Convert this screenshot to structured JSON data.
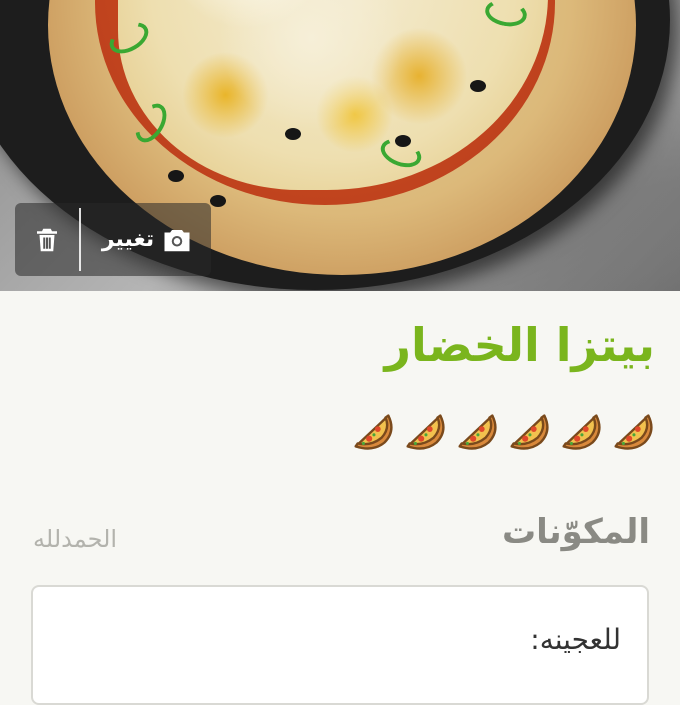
{
  "recipe": {
    "title": "بيتزا الخضار",
    "servings_count": 6,
    "servings_icon": "pizza-slice-icon"
  },
  "photo": {
    "change_label": "تغيير",
    "change_icon": "camera-icon",
    "delete_icon": "trash-icon"
  },
  "ingredients": {
    "heading": "المكوّنات",
    "note": "الحمدلله",
    "first_line": "للعجينه:"
  },
  "colors": {
    "title_green": "#7ab51d",
    "heading_gray": "#8a8a84",
    "page_bg": "#f7f7f3"
  }
}
